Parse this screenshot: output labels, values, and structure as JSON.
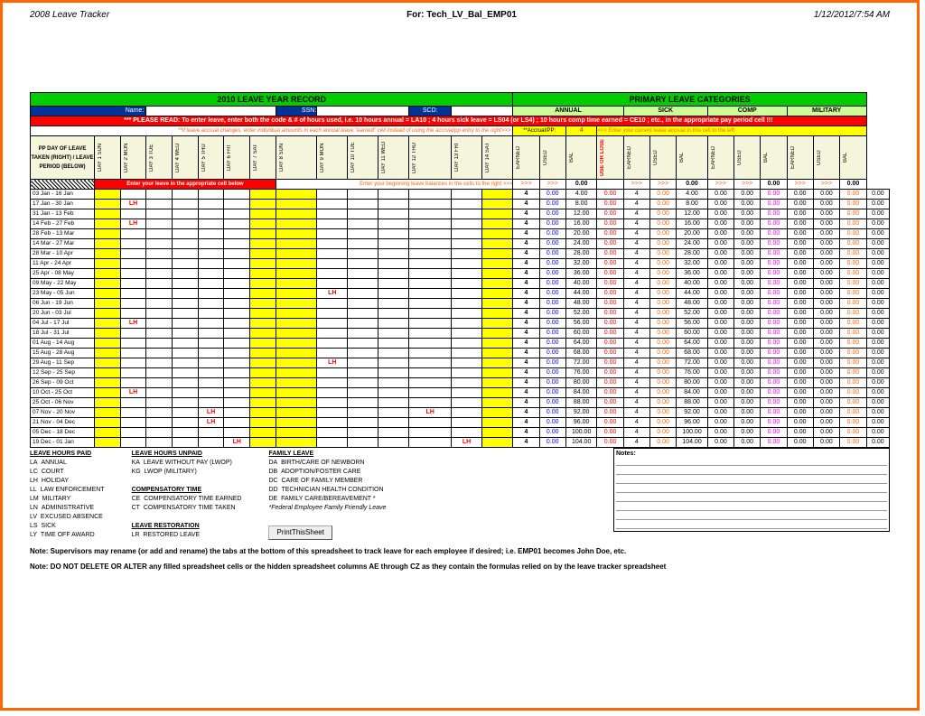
{
  "header": {
    "left": "2008 Leave Tracker",
    "center": "For: Tech_LV_Bal_EMP01",
    "right": "1/12/2012/7:54 AM"
  },
  "titles": {
    "left": "2010 LEAVE YEAR RECORD",
    "right": "PRIMARY LEAVE CATEGORIES"
  },
  "labels": {
    "name": "Name:",
    "ssn": "SSN:",
    "scd": "SCD:"
  },
  "cats": [
    "ANNUAL",
    "SICK",
    "COMP",
    "MILITARY"
  ],
  "instruction": "*** PLEASE READ: To enter leave, enter both the code & # of hours used, i.e. 10 hours annual = LA10 ; 4 hours sick leave = LS04 (or LS4) ; 10 hours comp time earned = CE10 ; etc., in the appropriate pay period cell !!!",
  "accrual_note": "**If leave accrual changes, enter individual amounts in each annual leave \"earned\" cell instead of using the accrual/pp entry to the right>>>",
  "accrual_label": "**Accrual/PP:",
  "accrual_val": "4",
  "accrual_hint": "<<< Enter your current leave accrual in this cell to the left",
  "ppday": "PP DAY OF LEAVE TAKEN (RIGHT) / LEAVE PERIOD (BELOW)",
  "days": [
    "DAY 1 SUN",
    "DAY 2 MON",
    "DAY 3 TUE",
    "DAY 4 WED",
    "DAY 5 THU",
    "DAY 6 FRI",
    "DAY 7 SAT",
    "DAY 8 SUN",
    "DAY 9 MON",
    "DAY 10 TUE",
    "DAY 11 WED",
    "DAY 12 THU",
    "DAY 13 FRI",
    "DAY 14 SAT"
  ],
  "subs": [
    "EARNED",
    "USED",
    "BAL",
    "USE OR LOSE",
    "EARNED",
    "USED",
    "BAL",
    "EARNED",
    "USED",
    "BAL",
    "EARNED",
    "USED",
    "BAL"
  ],
  "hint1": "Enter your leave in the appropriate cell below",
  "hint2": "Enter your beginning leave balances in the cells to the right >>>",
  "rows": [
    {
      "p": "03 Jan - 16 Jan",
      "lh": [],
      "a": [
        "4",
        "0.00",
        "4.00",
        "0.00"
      ],
      "s": [
        "4",
        "0.00",
        "4.00",
        "0.00"
      ],
      "c": [
        "0.00",
        "0.00",
        "0.00"
      ],
      "m": [
        "0.00",
        "0.00",
        "0.00"
      ]
    },
    {
      "p": "17 Jan - 30 Jan",
      "lh": [
        2
      ],
      "a": [
        "4",
        "0.00",
        "8.00",
        "0.00"
      ],
      "s": [
        "4",
        "0.00",
        "8.00",
        "0.00"
      ],
      "c": [
        "0.00",
        "0.00",
        "0.00"
      ],
      "m": [
        "0.00",
        "0.00",
        "0.00"
      ]
    },
    {
      "p": "31 Jan - 13 Feb",
      "lh": [],
      "a": [
        "4",
        "0.00",
        "12.00",
        "0.00"
      ],
      "s": [
        "4",
        "0.00",
        "12.00",
        "0.00"
      ],
      "c": [
        "0.00",
        "0.00",
        "0.00"
      ],
      "m": [
        "0.00",
        "0.00",
        "0.00"
      ]
    },
    {
      "p": "14 Feb - 27 Feb",
      "lh": [
        2
      ],
      "a": [
        "4",
        "0.00",
        "16.00",
        "0.00"
      ],
      "s": [
        "4",
        "0.00",
        "16.00",
        "0.00"
      ],
      "c": [
        "0.00",
        "0.00",
        "0.00"
      ],
      "m": [
        "0.00",
        "0.00",
        "0.00"
      ]
    },
    {
      "p": "28 Feb - 13 Mar",
      "lh": [],
      "a": [
        "4",
        "0.00",
        "20.00",
        "0.00"
      ],
      "s": [
        "4",
        "0.00",
        "20.00",
        "0.00"
      ],
      "c": [
        "0.00",
        "0.00",
        "0.00"
      ],
      "m": [
        "0.00",
        "0.00",
        "0.00"
      ]
    },
    {
      "p": "14 Mar - 27 Mar",
      "lh": [],
      "a": [
        "4",
        "0.00",
        "24.00",
        "0.00"
      ],
      "s": [
        "4",
        "0.00",
        "24.00",
        "0.00"
      ],
      "c": [
        "0.00",
        "0.00",
        "0.00"
      ],
      "m": [
        "0.00",
        "0.00",
        "0.00"
      ]
    },
    {
      "p": "28 Mar - 10 Apr",
      "lh": [],
      "a": [
        "4",
        "0.00",
        "28.00",
        "0.00"
      ],
      "s": [
        "4",
        "0.00",
        "28.00",
        "0.00"
      ],
      "c": [
        "0.00",
        "0.00",
        "0.00"
      ],
      "m": [
        "0.00",
        "0.00",
        "0.00"
      ]
    },
    {
      "p": "11 Apr - 24 Apr",
      "lh": [],
      "a": [
        "4",
        "0.00",
        "32.00",
        "0.00"
      ],
      "s": [
        "4",
        "0.00",
        "32.00",
        "0.00"
      ],
      "c": [
        "0.00",
        "0.00",
        "0.00"
      ],
      "m": [
        "0.00",
        "0.00",
        "0.00"
      ]
    },
    {
      "p": "25 Apr - 08 May",
      "lh": [],
      "a": [
        "4",
        "0.00",
        "36.00",
        "0.00"
      ],
      "s": [
        "4",
        "0.00",
        "36.00",
        "0.00"
      ],
      "c": [
        "0.00",
        "0.00",
        "0.00"
      ],
      "m": [
        "0.00",
        "0.00",
        "0.00"
      ]
    },
    {
      "p": "09 May - 22 May",
      "lh": [],
      "a": [
        "4",
        "0.00",
        "40.00",
        "0.00"
      ],
      "s": [
        "4",
        "0.00",
        "40.00",
        "0.00"
      ],
      "c": [
        "0.00",
        "0.00",
        "0.00"
      ],
      "m": [
        "0.00",
        "0.00",
        "0.00"
      ]
    },
    {
      "p": "23 May - 05 Jun",
      "lh": [
        9
      ],
      "a": [
        "4",
        "0.00",
        "44.00",
        "0.00"
      ],
      "s": [
        "4",
        "0.00",
        "44.00",
        "0.00"
      ],
      "c": [
        "0.00",
        "0.00",
        "0.00"
      ],
      "m": [
        "0.00",
        "0.00",
        "0.00"
      ]
    },
    {
      "p": "06 Jun - 19 Jun",
      "lh": [],
      "a": [
        "4",
        "0.00",
        "48.00",
        "0.00"
      ],
      "s": [
        "4",
        "0.00",
        "48.00",
        "0.00"
      ],
      "c": [
        "0.00",
        "0.00",
        "0.00"
      ],
      "m": [
        "0.00",
        "0.00",
        "0.00"
      ]
    },
    {
      "p": "20 Jun - 03 Jul",
      "lh": [],
      "a": [
        "4",
        "0.00",
        "52.00",
        "0.00"
      ],
      "s": [
        "4",
        "0.00",
        "52.00",
        "0.00"
      ],
      "c": [
        "0.00",
        "0.00",
        "0.00"
      ],
      "m": [
        "0.00",
        "0.00",
        "0.00"
      ]
    },
    {
      "p": "04 Jul - 17 Jul",
      "lh": [
        2
      ],
      "a": [
        "4",
        "0.00",
        "56.00",
        "0.00"
      ],
      "s": [
        "4",
        "0.00",
        "56.00",
        "0.00"
      ],
      "c": [
        "0.00",
        "0.00",
        "0.00"
      ],
      "m": [
        "0.00",
        "0.00",
        "0.00"
      ]
    },
    {
      "p": "18 Jul - 31 Jul",
      "lh": [],
      "a": [
        "4",
        "0.00",
        "60.00",
        "0.00"
      ],
      "s": [
        "4",
        "0.00",
        "60.00",
        "0.00"
      ],
      "c": [
        "0.00",
        "0.00",
        "0.00"
      ],
      "m": [
        "0.00",
        "0.00",
        "0.00"
      ]
    },
    {
      "p": "01 Aug - 14 Aug",
      "lh": [],
      "a": [
        "4",
        "0.00",
        "64.00",
        "0.00"
      ],
      "s": [
        "4",
        "0.00",
        "64.00",
        "0.00"
      ],
      "c": [
        "0.00",
        "0.00",
        "0.00"
      ],
      "m": [
        "0.00",
        "0.00",
        "0.00"
      ]
    },
    {
      "p": "15 Aug - 28 Aug",
      "lh": [],
      "a": [
        "4",
        "0.00",
        "68.00",
        "0.00"
      ],
      "s": [
        "4",
        "0.00",
        "68.00",
        "0.00"
      ],
      "c": [
        "0.00",
        "0.00",
        "0.00"
      ],
      "m": [
        "0.00",
        "0.00",
        "0.00"
      ]
    },
    {
      "p": "29 Aug - 11 Sep",
      "lh": [
        9
      ],
      "a": [
        "4",
        "0.00",
        "72.00",
        "0.00"
      ],
      "s": [
        "4",
        "0.00",
        "72.00",
        "0.00"
      ],
      "c": [
        "0.00",
        "0.00",
        "0.00"
      ],
      "m": [
        "0.00",
        "0.00",
        "0.00"
      ]
    },
    {
      "p": "12 Sep - 25 Sep",
      "lh": [],
      "a": [
        "4",
        "0.00",
        "76.00",
        "0.00"
      ],
      "s": [
        "4",
        "0.00",
        "76.00",
        "0.00"
      ],
      "c": [
        "0.00",
        "0.00",
        "0.00"
      ],
      "m": [
        "0.00",
        "0.00",
        "0.00"
      ]
    },
    {
      "p": "26 Sep - 09 Oct",
      "lh": [],
      "a": [
        "4",
        "0.00",
        "80.00",
        "0.00"
      ],
      "s": [
        "4",
        "0.00",
        "80.00",
        "0.00"
      ],
      "c": [
        "0.00",
        "0.00",
        "0.00"
      ],
      "m": [
        "0.00",
        "0.00",
        "0.00"
      ]
    },
    {
      "p": "10 Oct - 25 Oct",
      "lh": [
        2
      ],
      "a": [
        "4",
        "0.00",
        "84.00",
        "0.00"
      ],
      "s": [
        "4",
        "0.00",
        "84.00",
        "0.00"
      ],
      "c": [
        "0.00",
        "0.00",
        "0.00"
      ],
      "m": [
        "0.00",
        "0.00",
        "0.00"
      ]
    },
    {
      "p": "25 Oct - 06 Nov",
      "lh": [],
      "a": [
        "4",
        "0.00",
        "88.00",
        "0.00"
      ],
      "s": [
        "4",
        "0.00",
        "88.00",
        "0.00"
      ],
      "c": [
        "0.00",
        "0.00",
        "0.00"
      ],
      "m": [
        "0.00",
        "0.00",
        "0.00"
      ]
    },
    {
      "p": "07 Nov - 20 Nov",
      "lh": [
        5,
        12
      ],
      "a": [
        "4",
        "0.00",
        "92.00",
        "0.00"
      ],
      "s": [
        "4",
        "0.00",
        "92.00",
        "0.00"
      ],
      "c": [
        "0.00",
        "0.00",
        "0.00"
      ],
      "m": [
        "0.00",
        "0.00",
        "0.00"
      ]
    },
    {
      "p": "21 Nov - 04 Dec",
      "lh": [
        5
      ],
      "a": [
        "4",
        "0.00",
        "96.00",
        "0.00"
      ],
      "s": [
        "4",
        "0.00",
        "96.00",
        "0.00"
      ],
      "c": [
        "0.00",
        "0.00",
        "0.00"
      ],
      "m": [
        "0.00",
        "0.00",
        "0.00"
      ]
    },
    {
      "p": "05 Dec - 18 Dec",
      "lh": [],
      "a": [
        "4",
        "0.00",
        "100.00",
        "0.00"
      ],
      "s": [
        "4",
        "0.00",
        "100.00",
        "0.00"
      ],
      "c": [
        "0.00",
        "0.00",
        "0.00"
      ],
      "m": [
        "0.00",
        "0.00",
        "0.00"
      ]
    },
    {
      "p": "19 Dec - 01 Jan",
      "lh": [
        6,
        13
      ],
      "a": [
        "4",
        "0.00",
        "104.00",
        "0.00"
      ],
      "s": [
        "4",
        "0.00",
        "104.00",
        "0.00"
      ],
      "c": [
        "0.00",
        "0.00",
        "0.00"
      ],
      "m": [
        "0.00",
        "0.00",
        "0.00"
      ]
    }
  ],
  "legend": {
    "paid": {
      "t": "LEAVE HOURS PAID",
      "items": [
        [
          "LA",
          "ANNUAL"
        ],
        [
          "LC",
          "COURT"
        ],
        [
          "LH",
          "HOLIDAY"
        ],
        [
          "LL",
          "LAW ENFORCEMENT"
        ],
        [
          "LM",
          "MILITARY"
        ],
        [
          "LN",
          "ADMINISTRATIVE"
        ],
        [
          "LV",
          "EXCUSED ABSENCE"
        ],
        [
          "LS",
          "SICK"
        ],
        [
          "LY",
          "TIME OFF AWARD"
        ]
      ]
    },
    "unpaid": {
      "t": "LEAVE HOURS UNPAID",
      "items": [
        [
          "KA",
          "LEAVE WITHOUT PAY (LWOP)"
        ],
        [
          "KG",
          "LWOP (MILITARY)"
        ]
      ]
    },
    "comp": {
      "t": "COMPENSATORY TIME",
      "items": [
        [
          "CE",
          "COMPENSATORY TIME EARNED"
        ],
        [
          "CT",
          "COMPENSATORY TIME TAKEN"
        ]
      ]
    },
    "rest": {
      "t": "LEAVE RESTORATION",
      "items": [
        [
          "LR",
          "RESTORED LEAVE"
        ]
      ]
    },
    "family": {
      "t": "FAMILY LEAVE",
      "items": [
        [
          "DA",
          "BIRTH/CARE OF NEWBORN"
        ],
        [
          "DB",
          "ADOPTION/FOSTER CARE"
        ],
        [
          "DC",
          "CARE OF FAMILY MEMBER"
        ],
        [
          "DD",
          "TECHNICIAN HEALTH CONDITION"
        ],
        [
          "DE",
          "FAMILY CARE/BEREAVEMENT *"
        ]
      ],
      "foot": "*Federal Employee Family Friendly Leave"
    }
  },
  "notesTitle": "Notes:",
  "print": "PrintThisSheet",
  "footnote1": "Note:  Supervisors may rename (or add and rename) the tabs at the bottom of this spreadsheet to track leave for each employee if desired;  i.e. EMP01 becomes John Doe, etc.",
  "footnote2": "Note: DO NOT DELETE OR ALTER any filled spreadsheet cells or the hidden spreadsheet columns AE through CZ as they contain the formulas relied on by the leave tracker spreadsheet"
}
